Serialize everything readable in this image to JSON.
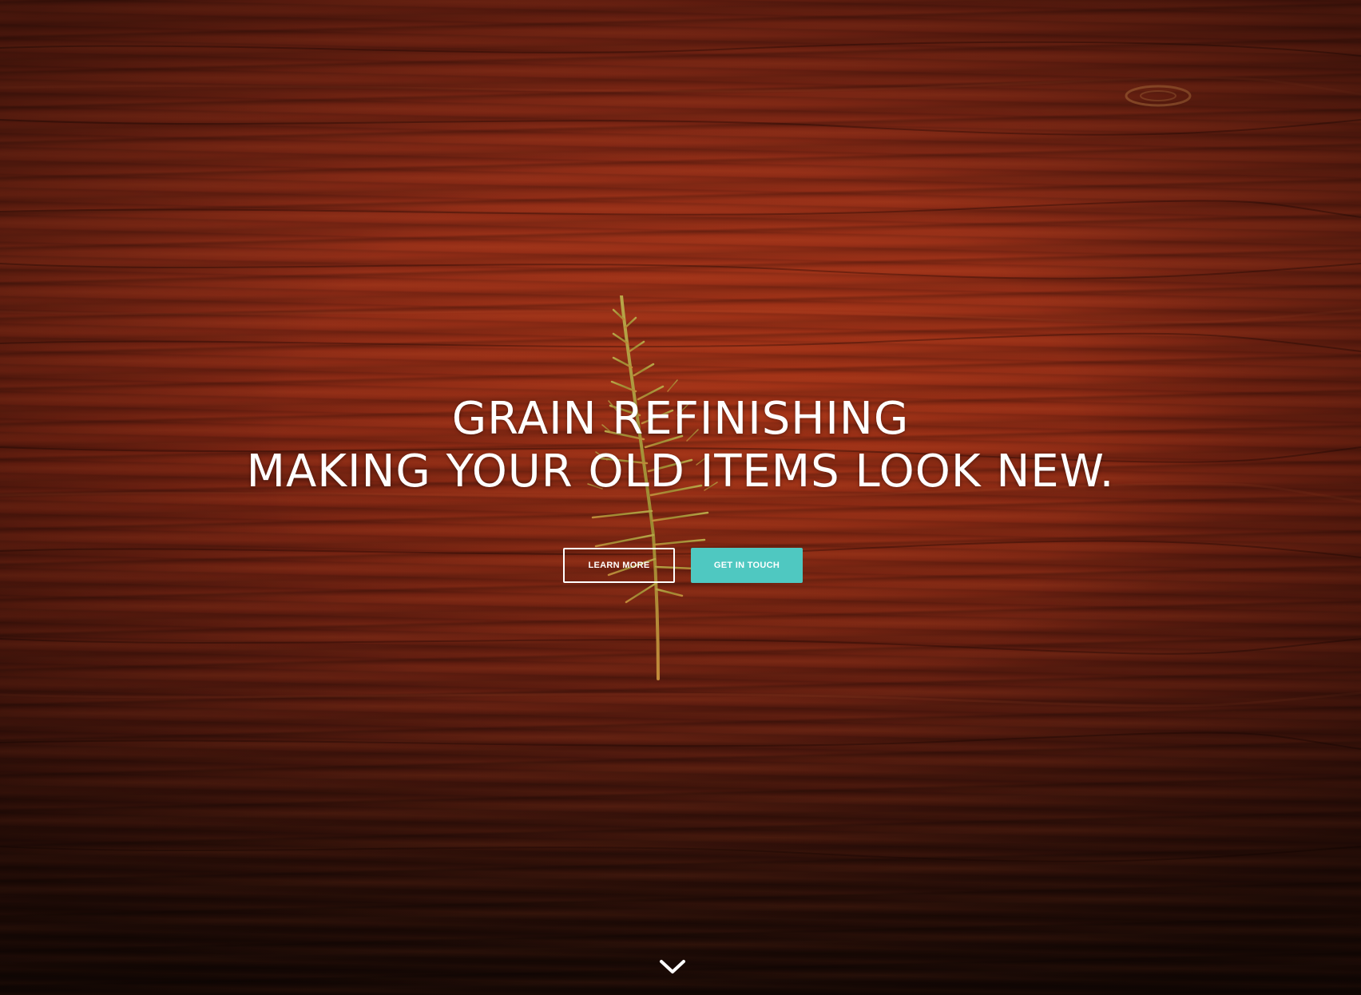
{
  "hero": {
    "headline_line1": "GRAIN REFINISHING",
    "headline_line2": "MAKING YOUR OLD ITEMS LOOK NEW.",
    "background": "wood-grain-with-fern",
    "buttons": {
      "learn_more": "LEARN MORE",
      "get_in_touch": "GET IN TOUCH"
    },
    "scroll_icon": "chevron-down-icon"
  },
  "colors": {
    "accent": "#4fc8c1",
    "text": "#ffffff",
    "wood": "#7a2413"
  }
}
